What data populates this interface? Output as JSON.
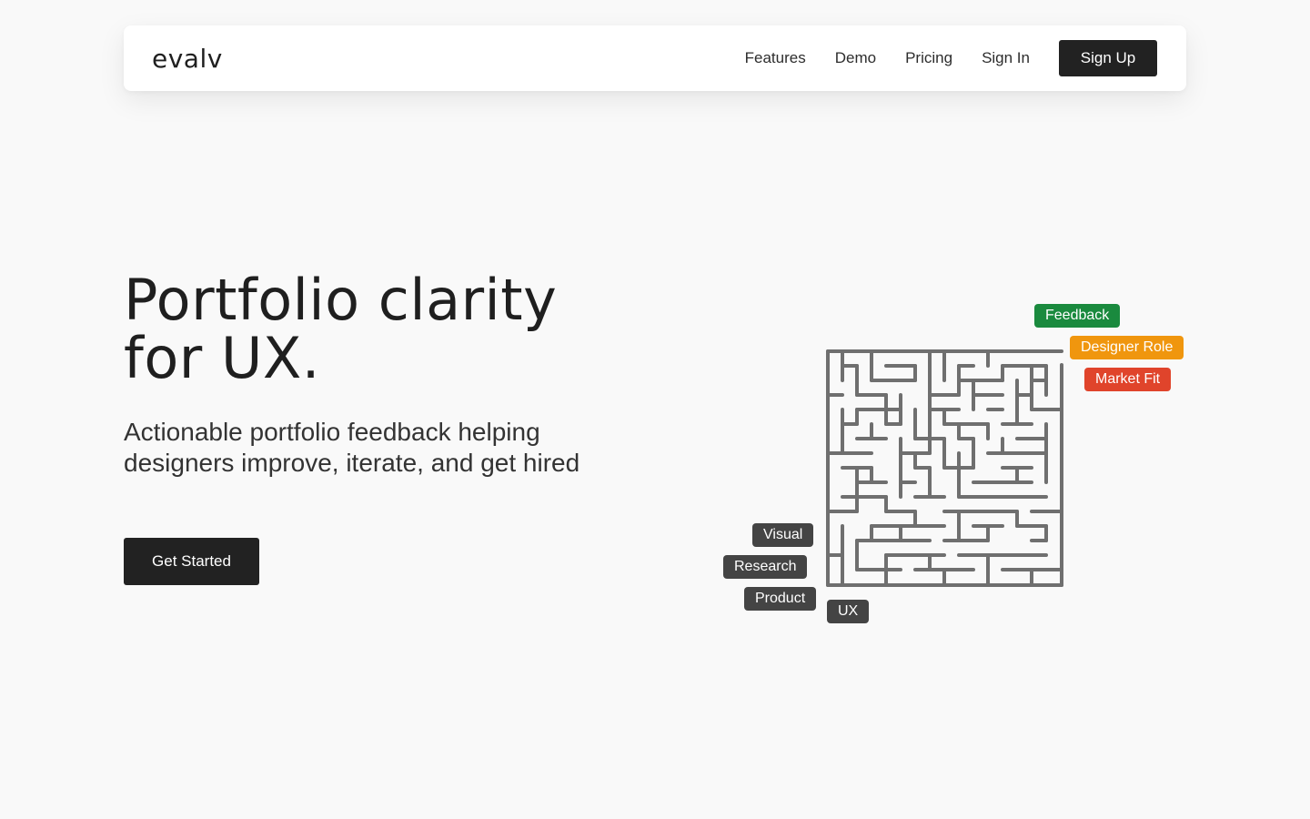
{
  "brand": "evalv",
  "nav": {
    "links": [
      "Features",
      "Demo",
      "Pricing",
      "Sign In"
    ],
    "signup_label": "Sign Up"
  },
  "hero": {
    "title_line1": "Portfolio clarity",
    "title_line2": "for UX.",
    "subtitle_line1": "Actionable portfolio feedback helping",
    "subtitle_line2": "designers improve, iterate, and get hired",
    "cta_label": "Get Started"
  },
  "maze": {
    "exit_tags": [
      {
        "label": "Feedback",
        "color": "#1a8a3e"
      },
      {
        "label": "Designer Role",
        "color": "#f0960e"
      },
      {
        "label": "Market Fit",
        "color": "#e0442b"
      }
    ],
    "entry_tags": [
      {
        "label": "Visual",
        "color": "#444444"
      },
      {
        "label": "Research",
        "color": "#444444"
      },
      {
        "label": "Product",
        "color": "#444444"
      },
      {
        "label": "UX",
        "color": "#444444"
      }
    ],
    "wall_color": "#6f6f6f"
  }
}
